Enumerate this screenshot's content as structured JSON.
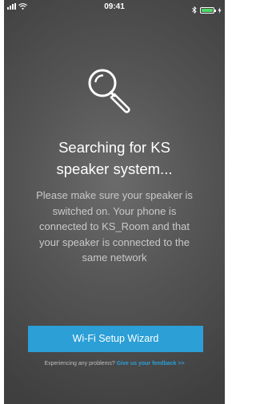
{
  "status_bar": {
    "time": "09:41"
  },
  "main": {
    "title": "Searching for KS\nspeaker system...",
    "message": "Please make sure your speaker is\nswitched on. Your phone is\nconnected to KS_Room and that\nyour speaker is connected to the\nsame network",
    "wizard_button": "Wi-Fi Setup Wizard",
    "feedback_prompt": "Experiencing any problems?",
    "feedback_link": "Give us your feedback >>"
  },
  "colors": {
    "accent": "#2b9fd6",
    "background": "#555555",
    "battery": "#4cd964"
  }
}
